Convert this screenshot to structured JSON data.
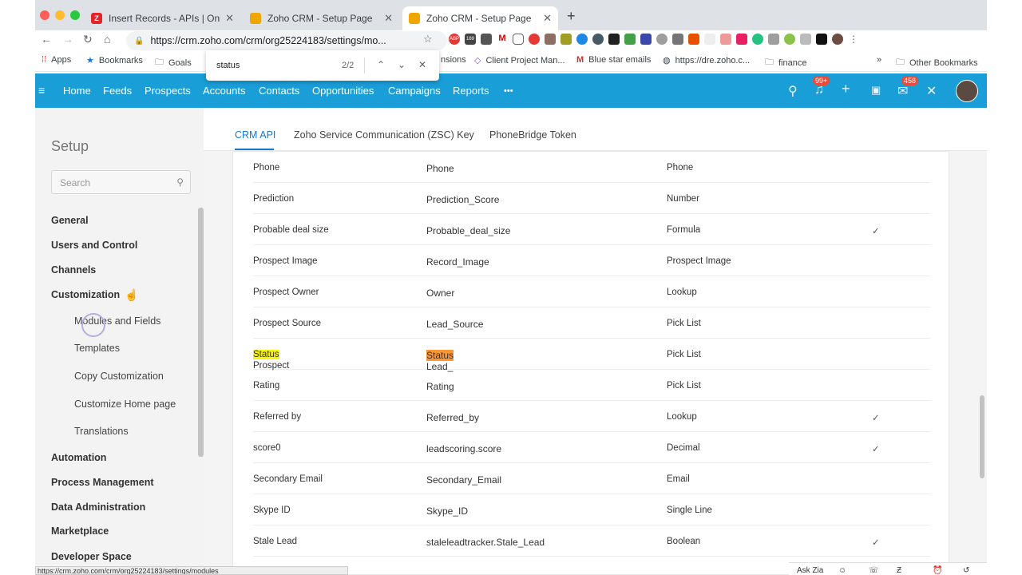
{
  "browser": {
    "tabs": [
      {
        "title": "Insert Records - APIs | Online Help",
        "icon": "zoho-z-icon",
        "color": "#e42527"
      },
      {
        "title": "Zoho CRM - Setup Page",
        "icon": "zoho-crm-icon",
        "color": "#f0a500"
      },
      {
        "title": "Zoho CRM - Setup Page",
        "icon": "zoho-crm-icon",
        "color": "#f0a500"
      }
    ],
    "url": "https://crm.zoho.com/crm/org25224183/settings/mo...",
    "ext_badges": {
      "abp": "ABP",
      "cal": "169",
      "mail": "6"
    },
    "bookmarks": [
      {
        "label": "Apps",
        "icon": "apps-grid-icon"
      },
      {
        "label": "Bookmarks",
        "icon": "star-icon"
      },
      {
        "label": "Goals",
        "icon": "folder-icon"
      },
      {
        "label": "nsions",
        "icon": "folder-icon"
      },
      {
        "label": "Client Project Man...",
        "icon": "diamond-icon"
      },
      {
        "label": "Blue star emails",
        "icon": "gmail-icon"
      },
      {
        "label": "https://dre.zoho.c...",
        "icon": "globe-icon"
      },
      {
        "label": "finance",
        "icon": "folder-icon"
      }
    ],
    "overflow": "»",
    "other_bookmarks": "Other Bookmarks",
    "find": {
      "query": "status",
      "count": "2/2"
    },
    "status_url": "https://crm.zoho.com/crm/org25224183/settings/modules"
  },
  "crm_nav": {
    "items": [
      "Home",
      "Feeds",
      "Prospects",
      "Accounts",
      "Contacts",
      "Opportunities",
      "Campaigns",
      "Reports"
    ],
    "more": "•••",
    "notif_badge": "99+",
    "mail_badge": "458"
  },
  "sidebar": {
    "title": "Setup",
    "search_placeholder": "Search",
    "items": [
      "General",
      "Users and Control",
      "Channels",
      "Customization"
    ],
    "sub_items": [
      "Modules and Fields",
      "Templates",
      "Copy Customization",
      "Customize Home page",
      "Translations"
    ],
    "items_after": [
      "Automation",
      "Process Management",
      "Data Administration",
      "Marketplace",
      "Developer Space"
    ]
  },
  "main": {
    "tabs": [
      "CRM API",
      "Zoho Service Communication (ZSC) Key",
      "PhoneBridge Token"
    ],
    "active_tab": "CRM API",
    "rows": [
      {
        "label": "Phone",
        "api": "Phone",
        "type": "Phone",
        "check": ""
      },
      {
        "label": "Prediction",
        "api": "Prediction_Score",
        "type": "Number",
        "check": ""
      },
      {
        "label": "Probable deal size",
        "api": "Probable_deal_size",
        "type": "Formula",
        "check": "✓"
      },
      {
        "label": "Prospect Image",
        "api": "Record_Image",
        "type": "Prospect Image",
        "check": ""
      },
      {
        "label": "Prospect Owner",
        "api": "Owner",
        "type": "Lookup",
        "check": ""
      },
      {
        "label": "Prospect Source",
        "api": "Lead_Source",
        "type": "Pick List",
        "check": ""
      },
      {
        "label": "Prospect ",
        "label_hl": "Status",
        "api": "Lead_",
        "api_hl": "Status",
        "type": "Pick List",
        "check": ""
      },
      {
        "label": "Rating",
        "api": "Rating",
        "type": "Pick List",
        "check": ""
      },
      {
        "label": "Referred by",
        "api": "Referred_by",
        "type": "Lookup",
        "check": "✓"
      },
      {
        "label": "score0",
        "api": "leadscoring.score",
        "type": "Decimal",
        "check": "✓"
      },
      {
        "label": "Secondary Email",
        "api": "Secondary_Email",
        "type": "Email",
        "check": ""
      },
      {
        "label": "Skype ID",
        "api": "Skype_ID",
        "type": "Single Line",
        "check": ""
      },
      {
        "label": "Stale Lead",
        "api": "staleleadtracker.Stale_Lead",
        "type": "Boolean",
        "check": "✓"
      }
    ]
  },
  "bottom": {
    "ask_zia": "Ask Zia"
  }
}
